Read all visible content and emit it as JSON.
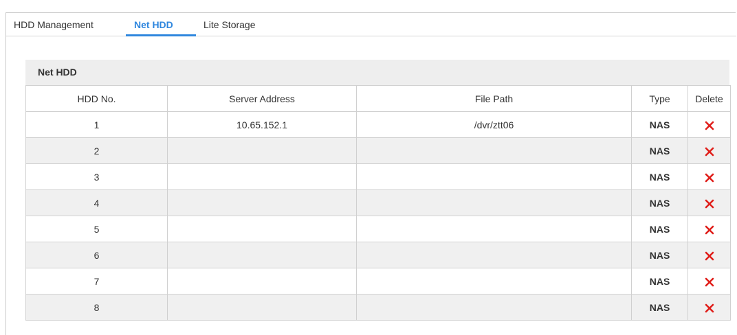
{
  "tabs": [
    {
      "label": "HDD Management",
      "active": false
    },
    {
      "label": "Net HDD",
      "active": true
    },
    {
      "label": "Lite Storage",
      "active": false
    }
  ],
  "panel": {
    "title": "Net HDD"
  },
  "table": {
    "headers": {
      "hdd_no": "HDD No.",
      "server_address": "Server Address",
      "file_path": "File Path",
      "type": "Type",
      "delete": "Delete"
    },
    "rows": [
      {
        "hdd_no": "1",
        "server_address": "10.65.152.1",
        "file_path": "/dvr/ztt06",
        "type": "NAS"
      },
      {
        "hdd_no": "2",
        "server_address": "",
        "file_path": "",
        "type": "NAS"
      },
      {
        "hdd_no": "3",
        "server_address": "",
        "file_path": "",
        "type": "NAS"
      },
      {
        "hdd_no": "4",
        "server_address": "",
        "file_path": "",
        "type": "NAS"
      },
      {
        "hdd_no": "5",
        "server_address": "",
        "file_path": "",
        "type": "NAS"
      },
      {
        "hdd_no": "6",
        "server_address": "",
        "file_path": "",
        "type": "NAS"
      },
      {
        "hdd_no": "7",
        "server_address": "",
        "file_path": "",
        "type": "NAS"
      },
      {
        "hdd_no": "8",
        "server_address": "",
        "file_path": "",
        "type": "NAS"
      }
    ]
  },
  "icons": {
    "delete": "close-icon"
  },
  "colors": {
    "accent": "#2e86de",
    "delete_icon": "#e0201c",
    "row_alt": "#f0f0f0",
    "panel_bg": "#eeeeee"
  }
}
